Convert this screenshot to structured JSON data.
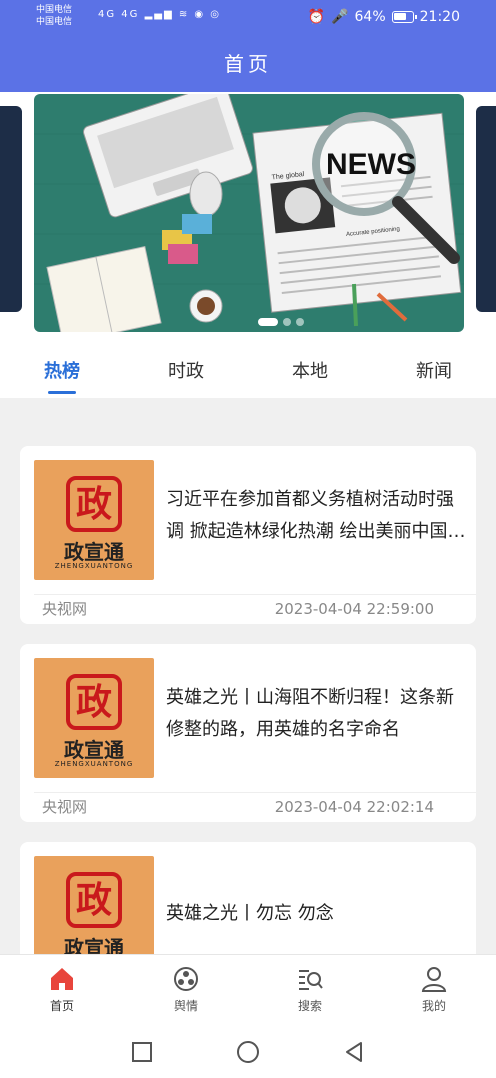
{
  "status_bar": {
    "carrier_1": "中国电信",
    "carrier_2": "中国电信",
    "network": "4G 4G",
    "battery": "64%",
    "time": "21:20"
  },
  "header": {
    "title": "首页"
  },
  "banner": {
    "headline": "NEWS",
    "caption_1": "The global",
    "caption_2": "Accurate positioning",
    "active_slide": 1,
    "slide_count": 3
  },
  "tabs": [
    {
      "label": "热榜",
      "active": true
    },
    {
      "label": "时政",
      "active": false
    },
    {
      "label": "本地",
      "active": false
    },
    {
      "label": "新闻",
      "active": false
    }
  ],
  "thumbnail": {
    "seal": "政",
    "brand": "政宣通",
    "brand_en": "ZHENGXUANTONG"
  },
  "news": [
    {
      "title": "习近平在参加首都义务植树活动时强调 掀起造林绿化热潮 绘出美丽中国的更新更美画卷",
      "source": "央视网",
      "time": "2023-04-04 22:59:00"
    },
    {
      "title": "英雄之光丨山海阻不断归程！这条新修整的路，用英雄的名字命名",
      "source": "央视网",
      "time": "2023-04-04 22:02:14"
    },
    {
      "title": "英雄之光丨勿忘 勿念",
      "source": "",
      "time": ""
    }
  ],
  "bottom_nav": [
    {
      "label": "首页",
      "icon": "home-icon",
      "active": true
    },
    {
      "label": "舆情",
      "icon": "opinion-icon",
      "active": false
    },
    {
      "label": "搜索",
      "icon": "search-list-icon",
      "active": false
    },
    {
      "label": "我的",
      "icon": "profile-icon",
      "active": false
    }
  ],
  "colors": {
    "brand": "#5b72e6",
    "tab_active": "#2a6fd8",
    "home_active": "#e8453c"
  }
}
